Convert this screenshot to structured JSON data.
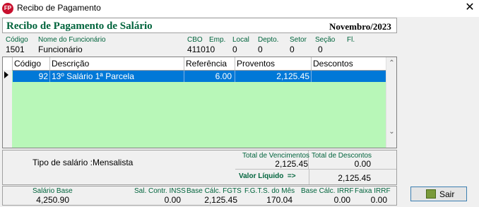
{
  "window": {
    "icon_text": "FP",
    "title": "Recibo de Pagamento",
    "close_glyph": "✕"
  },
  "header": {
    "heading": "Recibo de Pagamento de Salário",
    "month": "Novembro/2023"
  },
  "employee": {
    "labels": {
      "codigo": "Código",
      "nome": "Nome do Funcionário",
      "cbo": "CBO",
      "emp": "Emp.",
      "local": "Local",
      "depto": "Depto.",
      "setor": "Setor",
      "secao": "Seção",
      "fl": "Fl."
    },
    "values": {
      "codigo": "1501",
      "nome": "Funcionário",
      "cbo": "411010",
      "local": "0",
      "depto": "0",
      "setor": "0",
      "secao": "0"
    }
  },
  "grid": {
    "columns": [
      "Código",
      "Descrição",
      "Referência",
      "Proventos",
      "Descontos"
    ],
    "rows": [
      {
        "codigo": "92",
        "descricao": "13º Salário 1ª Parcela",
        "referencia": "6.00",
        "proventos": "2,125.45",
        "descontos": ""
      }
    ],
    "scroll_up": "⌃",
    "scroll_down": "⌄"
  },
  "summary": {
    "tipo_label": "Tipo de salário :",
    "tipo_value": "Mensalista",
    "total_venc_label": "Total de Vencimentos",
    "total_venc_value": "2,125.45",
    "total_desc_label": "Total de Descontos",
    "total_desc_value": "0.00",
    "liquido_label": "Valor Líquido  =>",
    "liquido_value": "2,125.45"
  },
  "footer": {
    "salario_base_label": "Salário Base",
    "salario_base_value": "4,250.90",
    "sal_inss_label": "Sal. Contr. INSS",
    "sal_inss_value": "0.00",
    "base_fgts_label": "Base Cálc. FGTS",
    "base_fgts_value": "2,125.45",
    "fgts_mes_label": "F.G.T.S. do Mês",
    "fgts_mes_value": "170.04",
    "base_irrf_label": "Base Cálc. IRRF",
    "base_irrf_value": "0.00",
    "faixa_irrf_label": "Faixa IRRF",
    "faixa_irrf_value": "0.00"
  },
  "buttons": {
    "sair": "Sair"
  }
}
